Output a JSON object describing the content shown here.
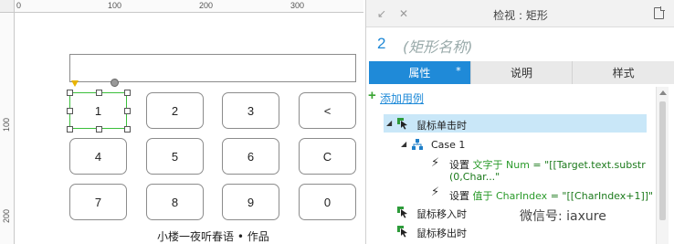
{
  "ruler": {
    "top_labels": [
      "0",
      "100",
      "200",
      "300"
    ],
    "left_labels": [
      "100",
      "200"
    ]
  },
  "canvas": {
    "keys": [
      "1",
      "2",
      "3",
      "<",
      "4",
      "5",
      "6",
      "C",
      "7",
      "8",
      "9",
      "0"
    ],
    "selected_key": "1",
    "credit": "小楼一夜听春语 • 作品"
  },
  "inspector": {
    "title": "检视 : 矩形",
    "nav_back": "↙",
    "nav_close": "✕",
    "shape_index": "2",
    "shape_name_placeholder": "(矩形名称)",
    "tabs": [
      {
        "label": "属性",
        "star": "*"
      },
      {
        "label": "说明"
      },
      {
        "label": "样式"
      }
    ],
    "add_case": "添加用例",
    "events": {
      "click": "鼠标单击时",
      "case": "Case 1",
      "action1_prefix": "设置",
      "action1_target": "文字于 Num",
      "action1_value": "= \"[[Target.text.substr",
      "action1_value2": "(0,Char...\"",
      "action2_prefix": "设置",
      "action2_target": "值于 CharIndex",
      "action2_value": "= \"[[CharIndex+1]]\"",
      "mouse_in": "鼠标移入时",
      "mouse_out": "鼠标移出时"
    },
    "accent_color": "#1f8ad8"
  },
  "watermark": "微信号: iaxure"
}
